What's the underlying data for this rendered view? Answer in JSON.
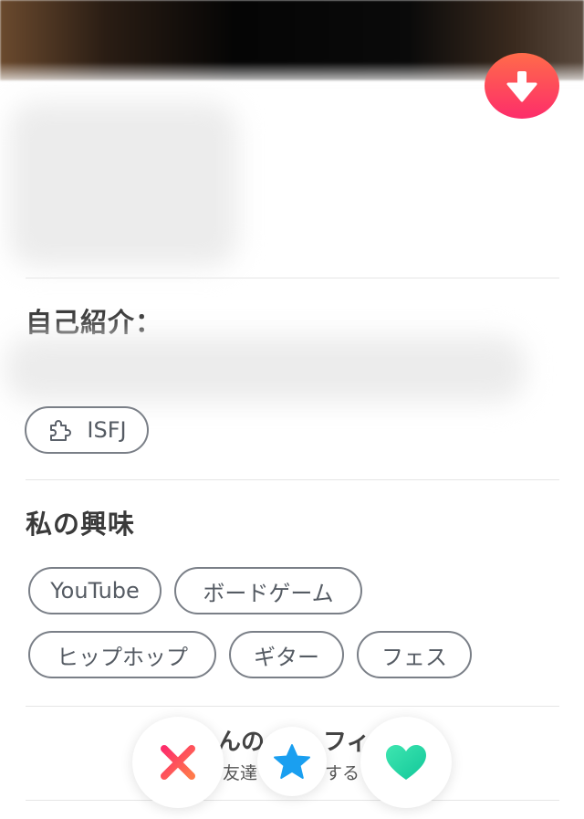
{
  "profile": {
    "bio": {
      "title": "自己紹介："
    },
    "personality": {
      "label": "ISFJ",
      "icon": "puzzle-icon"
    },
    "interests": {
      "title": "私の興味",
      "tags": [
        "YouTube",
        "ボードゲーム",
        "ヒップホップ",
        "ギター",
        "フェス"
      ]
    },
    "partially_hidden": {
      "title_fragments": [
        "んの",
        "フィ"
      ],
      "subtitle_fragments": [
        "友達",
        "する"
      ]
    }
  },
  "actions": {
    "scroll_down_icon": "arrow-down-icon",
    "dislike_icon": "x-icon",
    "super_like_icon": "star-icon",
    "like_icon": "heart-icon"
  },
  "colors": {
    "accent_gradient_start": "#ff6b4a",
    "accent_gradient_end": "#fd2d6a",
    "dislike": "#fd4a63",
    "super_like": "#1a9ff0",
    "like": "#1fd6a2",
    "chip_border": "#7a7f87"
  }
}
